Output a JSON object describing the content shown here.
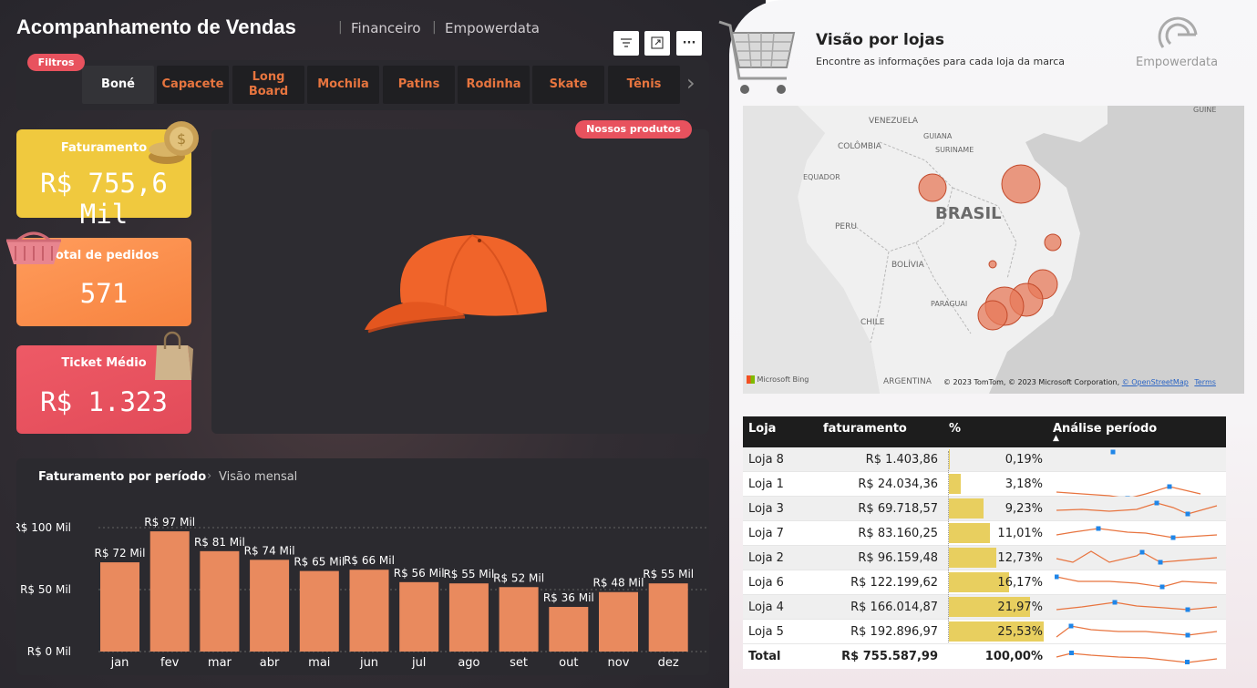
{
  "header": {
    "title": "Acompanhamento de Vendas",
    "sub1": "Financeiro",
    "sub2": "Empowerdata",
    "controls": {
      "filter_icon": "filter-icon",
      "expand_icon": "expand-icon",
      "more": "···"
    }
  },
  "filters": {
    "pill": "Filtros",
    "tabs": [
      "Boné",
      "Capacete",
      "Long\nBoard",
      "Mochila",
      "Patins",
      "Rodinha",
      "Skate",
      "Tênis"
    ],
    "active": "Boné",
    "next": "›"
  },
  "kpis": [
    {
      "label": "Faturamento",
      "value": "R$ 755,6 Mil",
      "color": "#f0c93e"
    },
    {
      "label": "Total de pedidos",
      "value": "571",
      "color": "#fb8e4c"
    },
    {
      "label": "Ticket Médio",
      "value": "R$ 1.323",
      "color": "#e8525e"
    }
  ],
  "products": {
    "pill": "Nossos produtos"
  },
  "revenue": {
    "title": "Faturamento por período",
    "crumb": "Visão mensal"
  },
  "chart_data": {
    "type": "bar",
    "title": "Faturamento por período",
    "categories": [
      "jan",
      "fev",
      "mar",
      "abr",
      "mai",
      "jun",
      "jul",
      "ago",
      "set",
      "out",
      "nov",
      "dez"
    ],
    "values": [
      72,
      97,
      81,
      74,
      65,
      66,
      56,
      55,
      52,
      36,
      48,
      55
    ],
    "labels": [
      "R$ 72 Mil",
      "R$ 97 Mil",
      "R$ 81 Mil",
      "R$ 74 Mil",
      "R$ 65 Mil",
      "R$ 66 Mil",
      "R$ 56 Mil",
      "R$ 55 Mil",
      "R$ 52 Mil",
      "R$ 36 Mil",
      "R$ 48 Mil",
      "R$ 55 Mil"
    ],
    "yticks": [
      "R$ 0 Mil",
      "R$ 50 Mil",
      "R$ 100 Mil"
    ],
    "ylim": [
      0,
      100
    ],
    "color": "#e98a5e"
  },
  "stores": {
    "title": "Visão por lojas",
    "subtitle": "Encontre as informações para cada loja da marca",
    "logo_text": "Empowerdata"
  },
  "map": {
    "labels": {
      "venezuela": "VENEZUELA",
      "colombia": "COLÔMBIA",
      "guiana": "GUIANA",
      "suriname": "SURINAME",
      "guine": "GUINE",
      "equador": "EQUADOR",
      "peru": "PERU",
      "brasil": "BRASIL",
      "bolivia": "BOLÍVIA",
      "paraguai": "PARAGUAI",
      "chile": "CHILE",
      "argentina": "ARGENTINA"
    },
    "bing": "Microsoft Bing",
    "copyright": "© 2023 TomTom, © 2023 Microsoft Corporation,",
    "osm": "© OpenStreetMap",
    "terms": "Terms"
  },
  "table": {
    "headers": [
      "Loja",
      "faturamento",
      "%",
      "Análise período"
    ],
    "rows": [
      {
        "loja": "Loja 8",
        "fat": "R$ 1.403,86",
        "pct": "0,19%",
        "p": 0.19
      },
      {
        "loja": "Loja 1",
        "fat": "R$ 24.034,36",
        "pct": "3,18%",
        "p": 3.18
      },
      {
        "loja": "Loja 3",
        "fat": "R$ 69.718,57",
        "pct": "9,23%",
        "p": 9.23
      },
      {
        "loja": "Loja 7",
        "fat": "R$ 83.160,25",
        "pct": "11,01%",
        "p": 11.01
      },
      {
        "loja": "Loja 2",
        "fat": "R$ 96.159,48",
        "pct": "12,73%",
        "p": 12.73
      },
      {
        "loja": "Loja 6",
        "fat": "R$ 122.199,62",
        "pct": "16,17%",
        "p": 16.17
      },
      {
        "loja": "Loja 4",
        "fat": "R$ 166.014,87",
        "pct": "21,97%",
        "p": 21.97
      },
      {
        "loja": "Loja 5",
        "fat": "R$ 192.896,97",
        "pct": "25,53%",
        "p": 25.53
      }
    ],
    "total": {
      "loja": "Total",
      "fat": "R$ 755.587,99",
      "pct": "100,00%"
    }
  }
}
